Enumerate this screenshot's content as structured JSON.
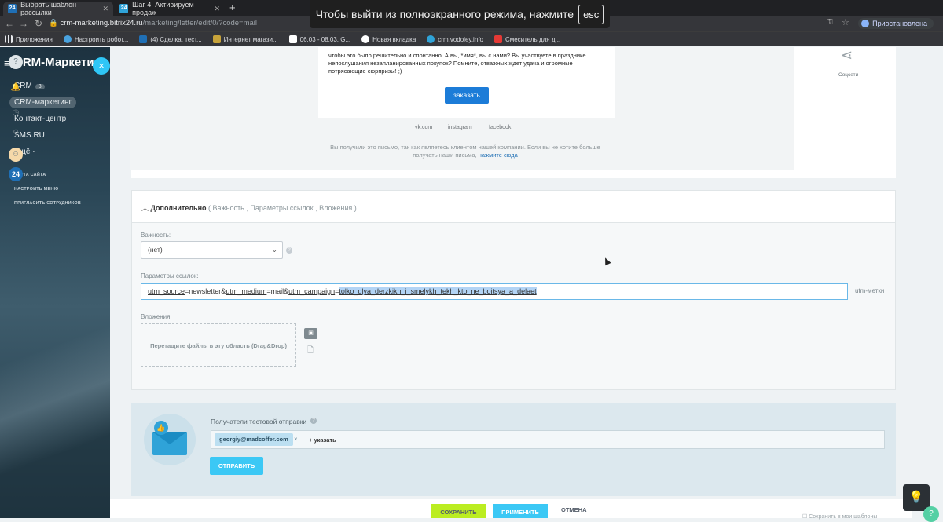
{
  "browser": {
    "tabs": [
      {
        "title": "Выбрать шаблон рассылки",
        "icon": "24",
        "icon_color": "#1f6fb5"
      },
      {
        "title": "Шаг 4. Активируем продаж",
        "icon": "24",
        "icon_color": "#2fa3d8"
      }
    ],
    "new_tab": "+",
    "url_host": "crm-marketing.bitrix24.ru",
    "url_path": "/marketing/letter/edit/0/?code=mail",
    "profile": "Приостановлена",
    "bookmarks": [
      {
        "label": "Приложения",
        "color": "#e8eaed"
      },
      {
        "label": "Настроить робот...",
        "color": "#4aa3df"
      },
      {
        "label": "(4) Сделка. тест...",
        "color": "#1f6fb5"
      },
      {
        "label": "Интернет магази...",
        "color": "#c7a33a"
      },
      {
        "label": "06.03 - 08.03, G...",
        "color": "#ffffff"
      },
      {
        "label": "Новая вкладка",
        "color": "#ffffff"
      },
      {
        "label": "crm.vodoley.info",
        "color": "#2fa3d8"
      },
      {
        "label": "Смеситель для д...",
        "color": "#e53935"
      }
    ],
    "fullscreen_notice": "Чтобы выйти из полноэкранного режима, нажмите",
    "fullscreen_key": "esc"
  },
  "sidebar": {
    "title": "CRM-Маркетинг",
    "items": [
      {
        "label": "CRM",
        "count": "3"
      },
      {
        "label": "CRM-маркетинг"
      },
      {
        "label": "Контакт-центр"
      },
      {
        "label": "SMS.RU"
      },
      {
        "label": "Ещё ·"
      }
    ],
    "small_links": [
      "КАРТА САЙТА",
      "НАСТРОИТЬ МЕНЮ",
      "ПРИГЛАСИТЬ СОТРУДНИКОВ"
    ]
  },
  "preview": {
    "letter_text_1": "чтобы это было решительно и спонтанно. А вы, *имя*, вы с нами? Вы участвуете в празднике",
    "letter_text_2": "непослушания незапланированных покупок? Помните, отважных ждет удача и огромные",
    "letter_text_3": "потрясающие сюрпризы! ;)",
    "order_button": "заказать",
    "social": [
      "vk.com",
      "instagram",
      "facebook"
    ],
    "unsubscribe_text": "Вы получили это письмо, так как являетесь клиентом нашей компании. Если вы не хотите больше получать наши письма,",
    "unsubscribe_link": "нажмите сюда",
    "share_label": "Соцсети"
  },
  "extra": {
    "title": "Дополнительно",
    "sublinks": "( Важность ,  Параметры ссылок ,  Вложения )",
    "importance_label": "Важность:",
    "importance_value": "(нет)",
    "link_params_label": "Параметры ссылок:",
    "utm": {
      "k1": "utm_source",
      "v1": "=newsletter&",
      "k2": "utm_medium",
      "v2": "=mail&",
      "k3": "utm_campaign",
      "eq": "=",
      "v3": "tolko_dlya_derzkikh_i_smelykh_tekh_kto_ne_boitsya_a_delaet"
    },
    "utm_link": "utm-метки",
    "attachments_label": "Вложения:",
    "dropzone": "Перетащите файлы в эту область (Drag&Drop)"
  },
  "test_send": {
    "label": "Получатели тестовой отправки",
    "recipient": "georgiy@madcoffer.com",
    "remove": "×",
    "add": "+ указать",
    "send_button": "ОТПРАВИТЬ"
  },
  "footer": {
    "save": "СОХРАНИТЬ",
    "apply": "ПРИМЕНИТЬ",
    "cancel": "ОТМЕНА",
    "save_template": "Сохранить в мои шаблоны"
  },
  "right_bar": {
    "badge": "24"
  }
}
